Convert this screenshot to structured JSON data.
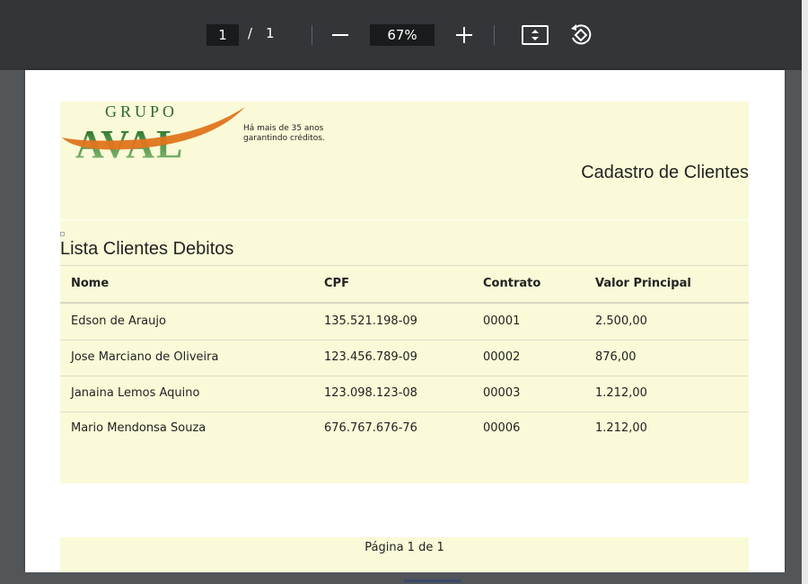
{
  "toolbar": {
    "current_page": "1",
    "page_separator": "/",
    "total_pages": "1",
    "zoom": "67%"
  },
  "icons": [
    "minus-icon",
    "plus-icon",
    "fit-page-icon",
    "rotate-icon"
  ],
  "colors": {
    "toolbar_bg": "#323639",
    "viewer_bg": "#525659",
    "band_bg": "#fafad8",
    "logo_green": "#2d7a2f",
    "logo_orange": "#e0741c"
  },
  "document": {
    "logo": {
      "line1": "GRUPO",
      "line2": "AVAL"
    },
    "tagline_line1": "Há mais de 35 anos",
    "tagline_line2": "garantindo créditos.",
    "title": "Cadastro de Clientes",
    "section_title": "Lista Clientes Debitos",
    "table": {
      "headers": [
        "Nome",
        "CPF",
        "Contrato",
        "Valor Principal"
      ],
      "rows": [
        [
          "Edson de Araujo",
          "135.521.198-09",
          "00001",
          "2.500,00"
        ],
        [
          "Jose Marciano de Oliveira",
          "123.456.789-09",
          "00002",
          "876,00"
        ],
        [
          "Janaina Lemos Aquino",
          "123.098.123-08",
          "00003",
          "1.212,00"
        ],
        [
          "Mario Mendonsa Souza",
          "676.767.676-76",
          "00006",
          "1.212,00"
        ]
      ]
    },
    "footer": "Página 1 de 1"
  }
}
